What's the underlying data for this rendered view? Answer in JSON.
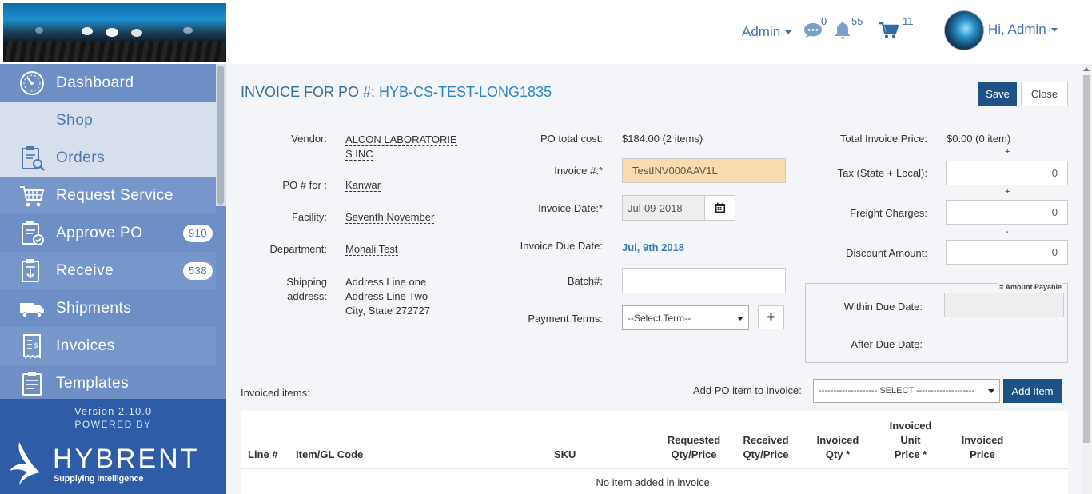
{
  "header": {
    "admin_menu": "Admin",
    "messages_count": "0",
    "notifications_count": "55",
    "cart_count": "11",
    "user_greeting": "Hi, Admin"
  },
  "sidebar": {
    "items": [
      {
        "label": "Dashboard",
        "icon": "dashboard-gauge-icon"
      },
      {
        "label": "Shop",
        "icon": ""
      },
      {
        "label": "Orders",
        "icon": "orders-clipboard-search-icon"
      },
      {
        "label": "Request Service",
        "icon": "request-service-cart-icon"
      },
      {
        "label": "Approve PO",
        "icon": "approve-clipboard-icon",
        "badge": "910"
      },
      {
        "label": "Receive",
        "icon": "receive-clipboard-icon",
        "badge": "538"
      },
      {
        "label": "Shipments",
        "icon": "truck-icon"
      },
      {
        "label": "Invoices",
        "icon": "invoice-icon"
      },
      {
        "label": "Templates",
        "icon": "template-clipboard-icon"
      }
    ],
    "version": "Version 2.10.0",
    "powered_by": "POWERED BY",
    "brand": "HYBRENT",
    "tagline": "Supplying Intelligence"
  },
  "invoice": {
    "title_prefix": "INVOICE FOR PO #: ",
    "po_number": "HYB-CS-TEST-LONG1835",
    "save_label": "Save",
    "close_label": "Close",
    "vendor_label": "Vendor:",
    "vendor_line1": "ALCON LABORATORIE",
    "vendor_line2": "S INC",
    "po_for_label": "PO # for :",
    "po_for_value": "Kanwar",
    "facility_label": "Facility:",
    "facility_value": "Seventh November",
    "department_label": "Department:",
    "department_value": "Mohali Test",
    "shipping_label_1": "Shipping",
    "shipping_label_2": "address:",
    "address_line1": "Address Line one",
    "address_line2": "Address Line Two",
    "address_line3": "City, State 272727",
    "po_total_label": "PO total cost:",
    "po_total_value": "$184.00 (2 items)",
    "invoice_no_label": "Invoice #:*",
    "invoice_no_value": "TestINV000AAV1L",
    "invoice_date_label": "Invoice Date:*",
    "invoice_date_value": "Jul-09-2018",
    "due_date_label": "Invoice Due Date:",
    "due_date_value": "Jul, 9th 2018",
    "batch_label": "Batch#:",
    "batch_value": "",
    "payment_terms_label": "Payment Terms:",
    "payment_terms_value": "--Select Term--",
    "add_term_label": "+",
    "total_price_label": "Total Invoice Price:",
    "total_price_value": "$0.00 (0 item)",
    "plus_sign": "+",
    "minus_sign": "-",
    "tax_label": "Tax (State + Local):",
    "tax_value": "0",
    "freight_label": "Freight Charges:",
    "freight_value": "0",
    "discount_label": "Discount Amount:",
    "discount_value": "0",
    "amount_payable_label": "= Amount Payable",
    "within_due_label": "Within Due Date:",
    "within_due_value": "",
    "after_due_label": "After Due Date:"
  },
  "items": {
    "section_label": "Invoiced items:",
    "add_po_label": "Add PO item to invoice:",
    "select_value": "-------------------- SELECT --------------------",
    "add_item_label": "Add Item",
    "columns": {
      "line": "Line #",
      "item": "Item/GL Code",
      "sku": "SKU",
      "requested_1": "Requested",
      "requested_2": "Qty/Price",
      "received_1": "Received",
      "received_2": "Qty/Price",
      "invoiced_qty_1": "Invoiced",
      "invoiced_qty_2": "Qty *",
      "unit_price_1": "Invoiced",
      "unit_price_2": "Unit",
      "unit_price_3": "Price *",
      "invoiced_price_1": "Invoiced",
      "invoiced_price_2": "Price"
    },
    "empty_message": "No item added in invoice."
  },
  "colors": {
    "sidebar": "#6d8fc6",
    "sidebar_footer": "#2f5ca7",
    "primary_button": "#1c5286",
    "link_blue": "#2f86c6",
    "invoice_field_highlight": "#f8dcad"
  }
}
